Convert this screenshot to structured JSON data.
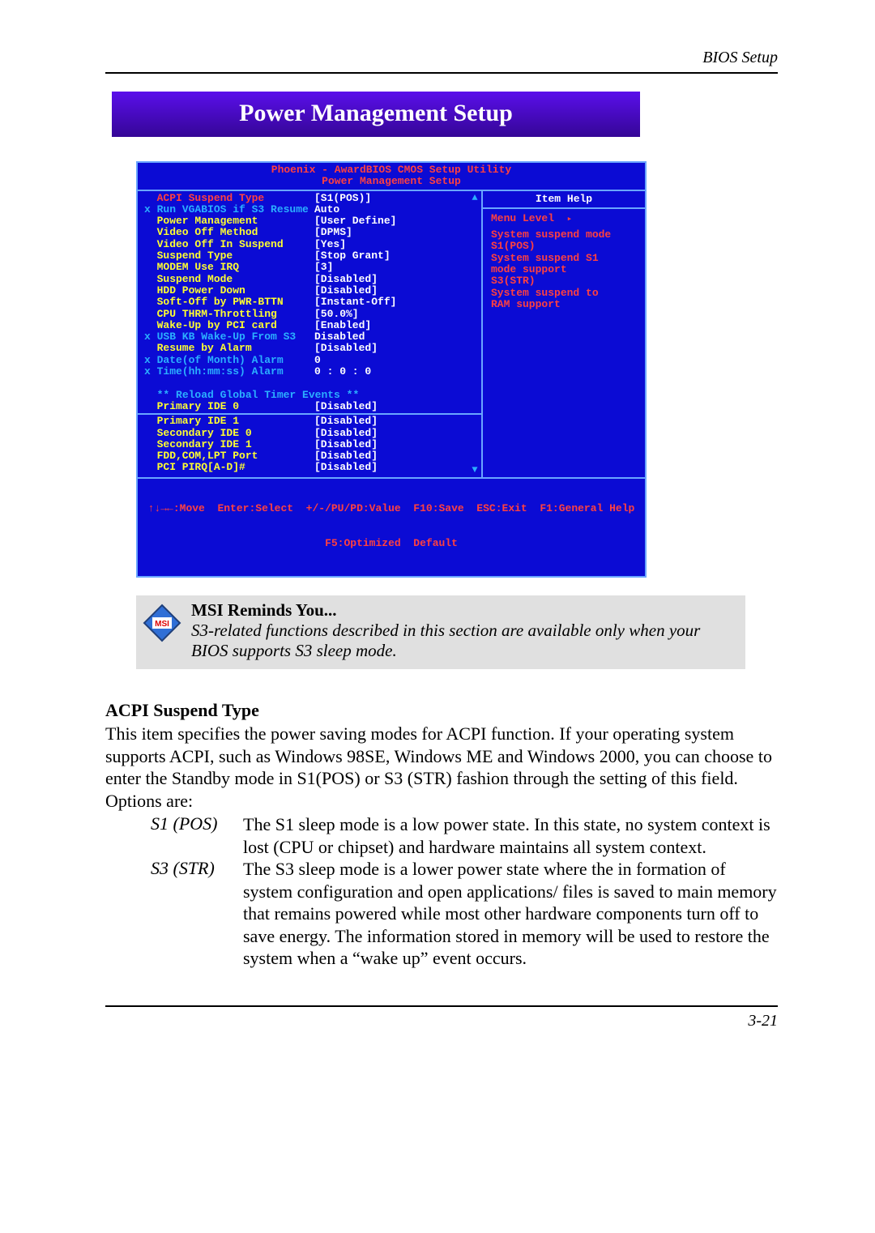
{
  "doc": {
    "header_right": "BIOS Setup",
    "page_title": "Power Management Setup",
    "page_number": "3-21"
  },
  "bios": {
    "utility_line": "Phoenix - AwardBIOS CMOS Setup Utility",
    "screen_title": "Power Management Setup",
    "rows_top": [
      {
        "x": " ",
        "label": "ACPI Suspend Type",
        "value": "[S1(POS)]",
        "valClass": "red",
        "sel": true
      },
      {
        "x": "x",
        "label": "Run VGABIOS if S3 Resume",
        "value": "Auto",
        "valClass": "blue2",
        "lblClass": "blue2"
      },
      {
        "x": " ",
        "label": "Power Management",
        "value": "[User Define]",
        "valClass": "yel"
      },
      {
        "x": " ",
        "label": "Video Off Method",
        "value": "[DPMS]",
        "valClass": "yel"
      },
      {
        "x": " ",
        "label": "Video Off In Suspend",
        "value": "[Yes]",
        "valClass": "yel"
      },
      {
        "x": " ",
        "label": "Suspend Type",
        "value": "[Stop Grant]",
        "valClass": "yel"
      },
      {
        "x": " ",
        "label": "MODEM Use IRQ",
        "value": "[3]",
        "valClass": "yel"
      },
      {
        "x": " ",
        "label": "Suspend Mode",
        "value": "[Disabled]",
        "valClass": "yel"
      },
      {
        "x": " ",
        "label": "HDD Power Down",
        "value": "[Disabled]",
        "valClass": "yel"
      },
      {
        "x": " ",
        "label": "Soft-Off by PWR-BTTN",
        "value": "[Instant-Off]",
        "valClass": "yel"
      },
      {
        "x": " ",
        "label": "CPU THRM-Throttling",
        "value": "[50.0%]",
        "valClass": "yel"
      },
      {
        "x": " ",
        "label": "Wake-Up by PCI card",
        "value": "[Enabled]",
        "valClass": "yel"
      },
      {
        "x": "x",
        "label": "USB KB Wake-Up From S3",
        "value": "Disabled",
        "valClass": "blue2",
        "lblClass": "blue2"
      },
      {
        "x": " ",
        "label": "Resume by Alarm",
        "value": "[Disabled]",
        "valClass": "yel"
      },
      {
        "x": "x",
        "label": "Date(of Month) Alarm",
        "value": "0",
        "valClass": "blue2",
        "lblClass": "blue2"
      },
      {
        "x": "x",
        "label": "Time(hh:mm:ss) Alarm",
        "value": "0 : 0 : 0",
        "valClass": "blue2",
        "lblClass": "blue2"
      }
    ],
    "events_header": "** Reload Global Timer Events **",
    "rows_mid": [
      {
        "x": " ",
        "label": "Primary IDE 0",
        "value": "[Disabled]",
        "valClass": "yel"
      }
    ],
    "rows_bottom": [
      {
        "x": " ",
        "label": "Primary IDE 1",
        "value": "[Disabled]",
        "valClass": "yel"
      },
      {
        "x": " ",
        "label": "Secondary IDE 0",
        "value": "[Disabled]",
        "valClass": "yel"
      },
      {
        "x": " ",
        "label": "Secondary IDE 1",
        "value": "[Disabled]",
        "valClass": "yel"
      },
      {
        "x": " ",
        "label": "FDD,COM,LPT Port",
        "value": "[Disabled]",
        "valClass": "yel"
      },
      {
        "x": " ",
        "label": "PCI PIRQ[A-D]#",
        "value": "[Disabled]",
        "valClass": "yel"
      }
    ],
    "help": {
      "title": "Item Help",
      "level": "Menu Level",
      "lines": [
        "System suspend mode",
        "S1(POS)",
        "System suspend S1",
        "mode support",
        "S3(STR)",
        "System suspend to",
        "RAM support"
      ]
    },
    "foot1": "↑↓→←:Move  Enter:Select  +/-/PU/PD:Value  F10:Save  ESC:Exit  F1:General Help",
    "foot2": "F5:Optimized  Default"
  },
  "msi": {
    "heading": "MSI Reminds You...",
    "body": "S3-related functions described in this section are available only when your BIOS supports S3 sleep mode.",
    "logo": "MSI"
  },
  "content": {
    "h1": "ACPI Suspend Type",
    "p1": "This item specifies the power saving modes for ACPI function. If your operating system supports ACPI, such as Windows 98SE, Windows ME and Windows 2000, you can choose to enter the Standby mode in S1(POS) or S3 (STR) fashion through the setting of this field. Options are:",
    "defs": [
      {
        "term": "S1 (POS)",
        "desc": "The S1 sleep mode is a low power state.  In this state, no system context is lost (CPU or chipset) and hardware maintains all system context."
      },
      {
        "term": "S3 (STR)",
        "desc": "The S3 sleep mode is a lower power state where the in formation of system configuration and open applications/ files is saved to main memory that remains powered while most other hardware components turn off to save energy. The information stored in memory will be used to restore the system when a “wake up” event occurs."
      }
    ]
  }
}
